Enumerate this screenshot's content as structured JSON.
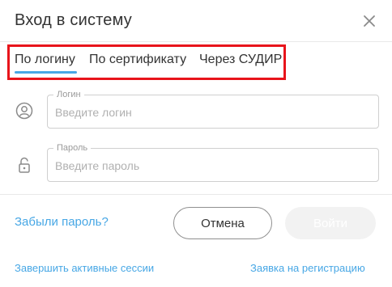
{
  "dialog": {
    "title": "Вход в систему"
  },
  "tabs": [
    {
      "label": "По логину",
      "active": true
    },
    {
      "label": "По сертификату",
      "active": false
    },
    {
      "label": "Через СУДИР",
      "active": false
    }
  ],
  "fields": {
    "login": {
      "label": "Логин",
      "placeholder": "Введите логин",
      "value": "",
      "icon": "user-icon"
    },
    "password": {
      "label": "Пароль",
      "placeholder": "Введите пароль",
      "value": "",
      "icon": "lock-icon"
    }
  },
  "actions": {
    "forgot_password": "Забыли пароль?",
    "cancel": "Отмена",
    "login": "Войти"
  },
  "links": {
    "end_sessions": "Завершить активные сессии",
    "register_request": "Заявка на регистрацию"
  },
  "colors": {
    "accent": "#47a7e5",
    "highlight_border": "#e8141b",
    "disabled_button": "#f2f2f2"
  }
}
